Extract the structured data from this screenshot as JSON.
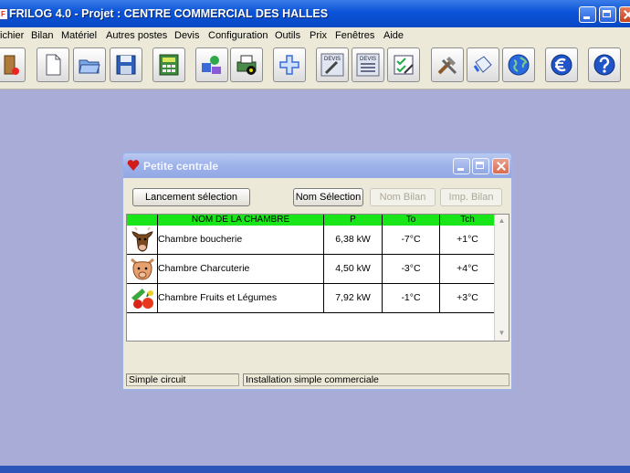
{
  "app": {
    "title": "FRILOG 4.0 - Projet : CENTRE COMMERCIAL DES HALLES",
    "icon_letter": "F"
  },
  "menu": [
    "ichier",
    "Bilan",
    "Matériel",
    "Autres postes",
    "Devis",
    "Configuration",
    "Outils",
    "Prix",
    "Fenêtres",
    "Aide"
  ],
  "toolbar": {
    "buttons": [
      "exit-icon",
      "new-document-icon",
      "open-folder-icon",
      "save-icon",
      "calculator-icon",
      "components-icon",
      "print-icon",
      "add-icon",
      "devis-tools-icon",
      "devis-list-icon",
      "checklist-icon",
      "tools-icon",
      "paint-bucket-icon",
      "globe-icon",
      "euro-icon",
      "help-icon"
    ],
    "devis_label": "DEVIS"
  },
  "child_window": {
    "title": "Petite centrale",
    "buttons": {
      "launch": "Lancement sélection",
      "nom_selection": "Nom Sélection",
      "nom_bilan": "Nom Bilan",
      "imp_bilan": "Imp. Bilan"
    },
    "table": {
      "headers": [
        "NOM DE LA CHAMBRE",
        "P",
        "To",
        "Tch"
      ],
      "rows": [
        {
          "icon": "cow-icon",
          "name": "Chambre boucherie",
          "p": "6,38 kW",
          "to": "-7°C",
          "tch": "+1°C"
        },
        {
          "icon": "pig-icon",
          "name": "Chambre Charcuterie",
          "p": "4,50 kW",
          "to": "-3°C",
          "tch": "+4°C"
        },
        {
          "icon": "fruits-vegetables-icon",
          "name": "Chambre Fruits et Légumes",
          "p": "7,92 kW",
          "to": "-1°C",
          "tch": "+3°C"
        }
      ]
    },
    "status": {
      "left": "Simple circuit",
      "right": "Installation simple commerciale"
    }
  },
  "colors": {
    "titlebar": "#0a53d8",
    "desktop": "#a8acd6",
    "header_green": "#19e619"
  }
}
